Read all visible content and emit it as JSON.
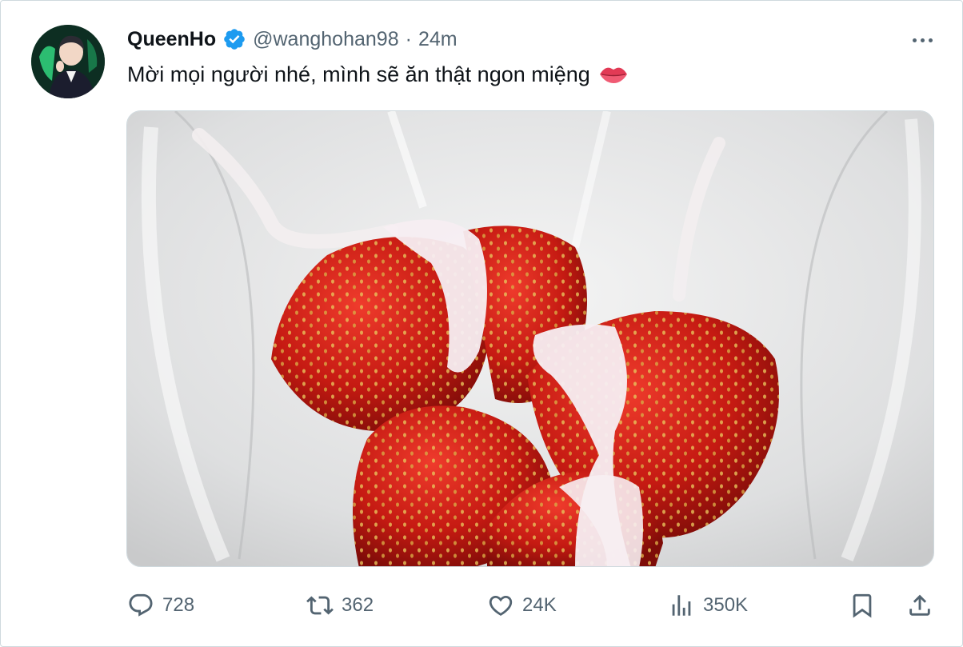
{
  "tweet": {
    "author": {
      "display_name": "QueenHo",
      "handle": "@wanghohan98",
      "verified": true,
      "avatar_icon": "user-avatar-photo"
    },
    "separator": "·",
    "time": "24m",
    "text": "Mời mọi người nhé, mình sẽ ăn thật ngon miệng",
    "emoji_icon": "lips-emoji-icon",
    "media": {
      "icon": "strawberries-with-cream-in-glass-bowl-photo"
    },
    "actions": {
      "reply": {
        "icon": "reply-icon",
        "count": "728"
      },
      "retweet": {
        "icon": "retweet-icon",
        "count": "362"
      },
      "like": {
        "icon": "heart-icon",
        "count": "24K"
      },
      "views": {
        "icon": "views-chart-icon",
        "count": "350K"
      },
      "bookmark": {
        "icon": "bookmark-icon"
      },
      "share": {
        "icon": "share-icon"
      }
    },
    "colors": {
      "text": "#0f1419",
      "secondary": "#536471",
      "verified": "#1d9bf0",
      "border": "#cfd9de"
    }
  }
}
